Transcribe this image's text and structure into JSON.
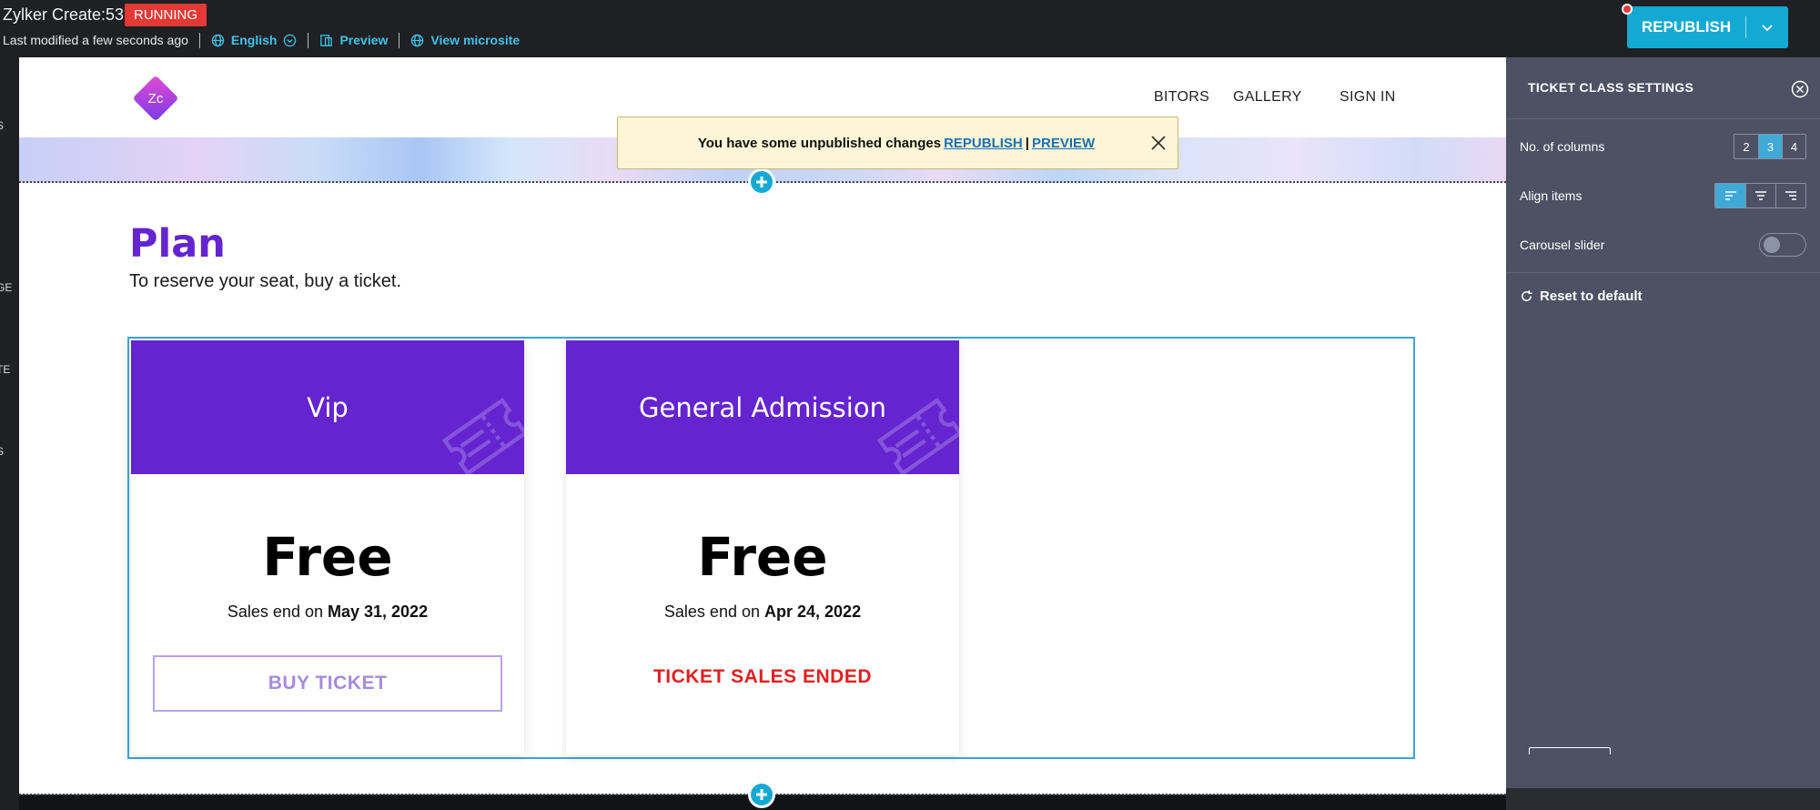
{
  "app": {
    "title": "Zylker Create:53",
    "status_badge": "RUNNING",
    "last_modified": "Last modified a few seconds ago",
    "language": "English",
    "preview": "Preview",
    "view_microsite": "View microsite",
    "republish_label": "REPUBLISH"
  },
  "left_rail": {
    "labels": [
      "S",
      "GE",
      "TE",
      "S"
    ]
  },
  "site": {
    "logo_text": "Zc",
    "nav": {
      "exhibitors": "BITORS",
      "gallery": "GALLERY",
      "sign_in": "SIGN IN"
    }
  },
  "banner": {
    "message": "You have some unpublished changes",
    "republish_link": "REPUBLISH",
    "separator": "|",
    "preview_link": "PREVIEW"
  },
  "plan": {
    "title": "Plan",
    "subtitle": "To reserve your seat, buy a ticket."
  },
  "tickets": [
    {
      "name": "Vip",
      "price": "Free",
      "sales_prefix": "Sales end on",
      "sales_date": "May 31, 2022",
      "action": "BUY TICKET"
    },
    {
      "name": "General Admission",
      "price": "Free",
      "sales_prefix": "Sales end on",
      "sales_date": "Apr 24, 2022",
      "status": "TICKET SALES ENDED"
    }
  ],
  "settings": {
    "title": "TICKET CLASS SETTINGS",
    "columns_label": "No. of columns",
    "columns_options": [
      "2",
      "3",
      "4"
    ],
    "columns_selected": "3",
    "align_label": "Align items",
    "align_options": [
      "align-left-icon",
      "align-center-icon",
      "align-right-icon"
    ],
    "align_selected": "align-left-icon",
    "carousel_label": "Carousel slider",
    "carousel_enabled": false,
    "reset_label": "Reset to default"
  },
  "colors": {
    "accent": "#14a9d2",
    "brand_purple": "#6424d0",
    "running": "#e53935",
    "sales_ended": "#e02020",
    "panel_bg": "#4c5163"
  }
}
